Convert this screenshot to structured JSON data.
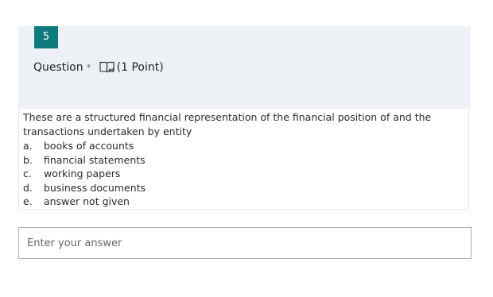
{
  "question": {
    "number": "5",
    "label": "Question",
    "required_mark": "*",
    "points": "(1 Point)",
    "icons": {
      "reader": "immersive-reader-icon"
    },
    "stem": "These are a structured financial representation of the financial position of  and the transactions undertaken by entity",
    "options": [
      {
        "letter": "a.",
        "text": "books of accounts"
      },
      {
        "letter": "b.",
        "text": "financial statements"
      },
      {
        "letter": "c.",
        "text": "working papers"
      },
      {
        "letter": "d.",
        "text": "business documents"
      },
      {
        "letter": "e.",
        "text": "answer not given"
      }
    ]
  },
  "answer": {
    "placeholder": "Enter your answer",
    "value": ""
  },
  "colors": {
    "accent": "#0e7a7c",
    "header_background": "#edf1f6"
  }
}
